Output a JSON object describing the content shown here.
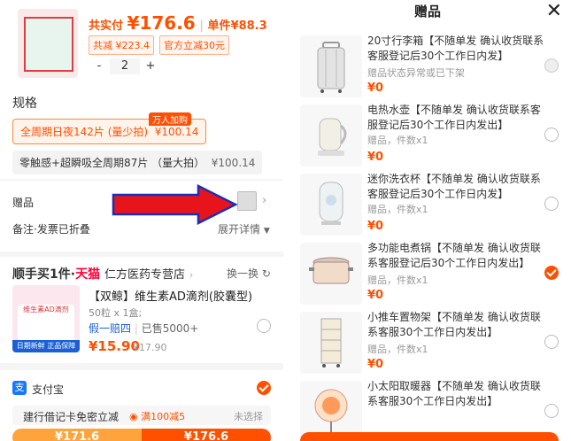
{
  "order": {
    "total_label": "共实付",
    "total_price": "¥176.6",
    "unit_label": "单件",
    "unit_price": "¥88.3",
    "discount_tag": "共减 ¥223.4",
    "official_tag": "官方立减30元",
    "qty_minus": "-",
    "qty_value": "2",
    "qty_plus": "+"
  },
  "spec": {
    "title": "规格",
    "badge": "万人加购",
    "option1": "全周期日夜142片 (量少拍)",
    "option1_price": "¥100.14",
    "option2": "零触感+超瞬吸全周期87片 （量大拍）",
    "option2_price": "¥100.14"
  },
  "gift_row": {
    "label": "赠品"
  },
  "remark_row": {
    "label": "备注·发票已折叠",
    "expand": "展开详情"
  },
  "shop": {
    "promo": "顺手买1件·",
    "tmall": "天猫",
    "name": "仁方医药专营店",
    "swap": "换一换",
    "product_name": "【双鲸】维生素AD滴剂(胶囊型)",
    "spec": "50粒 x 1盒;",
    "fake_tag": "假一赔四",
    "sold": "已售5000+",
    "price": "¥15.90",
    "orig_price": "¥17.90",
    "img_label": "日期新鲜 正品保障",
    "img_title": "维生素AD滴剂"
  },
  "payment": {
    "alipay": "支付宝",
    "bank_promo": "建行借记卡免密立减",
    "bank_tag": "满100减5",
    "bank_status": "未选择",
    "bar_left": "¥171.6",
    "bar_right": "¥176.6"
  },
  "gift_panel": {
    "title": "赠品",
    "close": "✕",
    "items": [
      {
        "title": "20寸行李箱【不随单发 确认收货联系客服登记后30个工作日内发】",
        "sub": "赠品状态异常或已下架",
        "price": "¥0"
      },
      {
        "title": "电热水壶【不随单发 确认收货联系客服登记后30个工作日内发出】",
        "sub": "赠品，件数x1",
        "price": "¥0"
      },
      {
        "title": "迷你洗衣杯【不随单发 确认收货联系客服登记后30个工作日内发】",
        "sub": "赠品，件数x1",
        "price": "¥0"
      },
      {
        "title": "多功能电煮锅【不随单发 确认收货联系客服登记后30个工作日内发出】",
        "sub": "赠品，件数x1",
        "price": "¥0"
      },
      {
        "title": "小推车置物架【不随单发 确认收货联系客服30个工作日内发出】",
        "sub": "赠品，件数x1",
        "price": "¥0"
      },
      {
        "title": "小太阳取暖器【不随单发 确认收货联系客服30个工作日内发出】",
        "sub": "",
        "price": ""
      }
    ]
  },
  "colors": {
    "accent": "#ff5000",
    "arrow_fill": "#e8141b",
    "arrow_stroke": "#1a2fb8"
  }
}
